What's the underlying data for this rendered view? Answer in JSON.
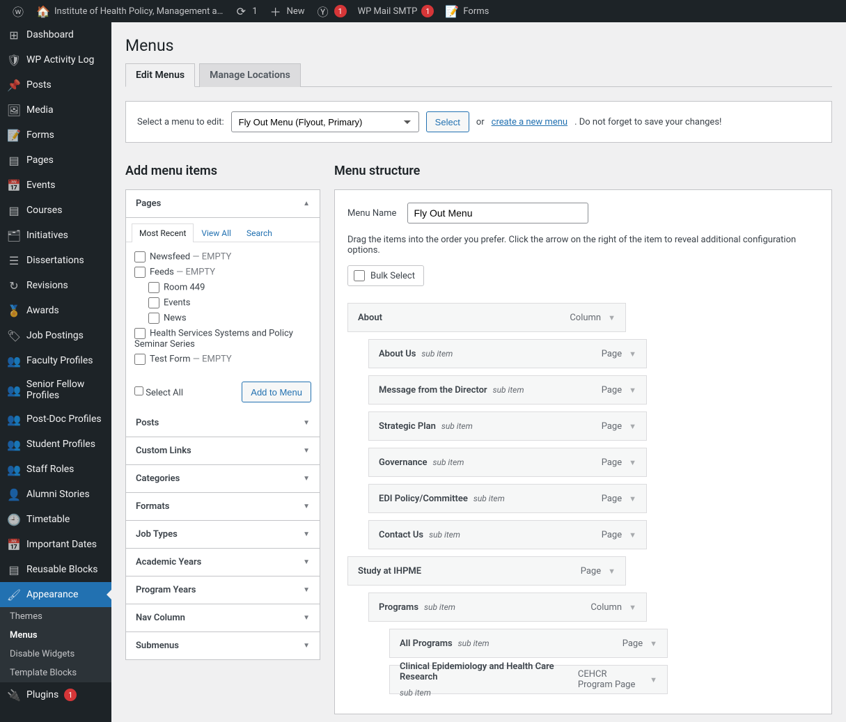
{
  "adminbar": {
    "site_name": "Institute of Health Policy, Management a…",
    "refresh_count": "1",
    "new_label": "New",
    "yoast_count": "1",
    "smtp_label": "WP Mail SMTP",
    "smtp_count": "1",
    "forms_label": "Forms"
  },
  "sidebar": {
    "items": [
      {
        "label": "Dashboard",
        "icon": "⊞"
      },
      {
        "label": "WP Activity Log",
        "icon": "🛡"
      },
      {
        "label": "Posts",
        "icon": "📌"
      },
      {
        "label": "Media",
        "icon": "🖼"
      },
      {
        "label": "Forms",
        "icon": "📝"
      },
      {
        "label": "Pages",
        "icon": "▤"
      },
      {
        "label": "Events",
        "icon": "📅"
      },
      {
        "label": "Courses",
        "icon": "▤"
      },
      {
        "label": "Initiatives",
        "icon": "🗂"
      },
      {
        "label": "Dissertations",
        "icon": "☰"
      },
      {
        "label": "Revisions",
        "icon": "↻"
      },
      {
        "label": "Awards",
        "icon": "🏅"
      },
      {
        "label": "Job Postings",
        "icon": "🏷"
      },
      {
        "label": "Faculty Profiles",
        "icon": "👥"
      },
      {
        "label": "Senior Fellow Profiles",
        "icon": "👥"
      },
      {
        "label": "Post-Doc Profiles",
        "icon": "👥"
      },
      {
        "label": "Student Profiles",
        "icon": "👥"
      },
      {
        "label": "Staff Roles",
        "icon": "👥"
      },
      {
        "label": "Alumni Stories",
        "icon": "👤"
      },
      {
        "label": "Timetable",
        "icon": "🕘"
      },
      {
        "label": "Important Dates",
        "icon": "📅"
      },
      {
        "label": "Reusable Blocks",
        "icon": "▤"
      },
      {
        "label": "Appearance",
        "icon": "🖌"
      },
      {
        "label": "Plugins",
        "icon": "🔌"
      }
    ],
    "appearance_sub": [
      "Themes",
      "Menus",
      "Disable Widgets",
      "Template Blocks"
    ],
    "plugins_badge": "1"
  },
  "page": {
    "title": "Menus",
    "tabs": {
      "edit": "Edit Menus",
      "locations": "Manage Locations"
    },
    "select_label": "Select a menu to edit:",
    "menu_selected": "Fly Out Menu (Flyout, Primary)",
    "select_btn": "Select",
    "or": "or",
    "create_link": "create a new menu",
    "save_note": ". Do not forget to save your changes!"
  },
  "add_items": {
    "heading": "Add menu items",
    "pages_label": "Pages",
    "inner_tabs": {
      "recent": "Most Recent",
      "view_all": "View All",
      "search": "Search"
    },
    "pages": [
      {
        "label": "Newsfeed",
        "suffix": " — EMPTY",
        "sub": false
      },
      {
        "label": "Feeds",
        "suffix": " — EMPTY",
        "sub": false
      },
      {
        "label": "Room 449",
        "suffix": "",
        "sub": true
      },
      {
        "label": "Events",
        "suffix": "",
        "sub": true
      },
      {
        "label": "News",
        "suffix": "",
        "sub": true
      },
      {
        "label": "Health Services Systems and Policy Seminar Series",
        "suffix": "",
        "sub": false
      },
      {
        "label": "Test Form",
        "suffix": " — EMPTY",
        "sub": false
      }
    ],
    "select_all": "Select All",
    "add_btn": "Add to Menu",
    "other_panels": [
      "Posts",
      "Custom Links",
      "Categories",
      "Formats",
      "Job Types",
      "Academic Years",
      "Program Years",
      "Nav Column",
      "Submenus"
    ]
  },
  "structure": {
    "heading": "Menu structure",
    "name_label": "Menu Name",
    "name_value": "Fly Out Menu",
    "help": "Drag the items into the order you prefer. Click the arrow on the right of the item to reveal additional configuration options.",
    "bulk": "Bulk Select",
    "items": [
      {
        "title": "About",
        "sub": "",
        "type": "Column",
        "depth": 0
      },
      {
        "title": "About Us",
        "sub": "sub item",
        "type": "Page",
        "depth": 1
      },
      {
        "title": "Message from the Director",
        "sub": "sub item",
        "type": "Page",
        "depth": 1
      },
      {
        "title": "Strategic Plan",
        "sub": "sub item",
        "type": "Page",
        "depth": 1
      },
      {
        "title": "Governance",
        "sub": "sub item",
        "type": "Page",
        "depth": 1
      },
      {
        "title": "EDI Policy/Committee",
        "sub": "sub item",
        "type": "Page",
        "depth": 1
      },
      {
        "title": "Contact Us",
        "sub": "sub item",
        "type": "Page",
        "depth": 1
      },
      {
        "title": "Study at IHPME",
        "sub": "",
        "type": "Page",
        "depth": 0
      },
      {
        "title": "Programs",
        "sub": "sub item",
        "type": "Column",
        "depth": 1
      },
      {
        "title": "All Programs",
        "sub": "sub item",
        "type": "Page",
        "depth": 2
      },
      {
        "title": "Clinical Epidemiology and Health Care Research",
        "sub": "sub item",
        "type": "CEHCR Program Page",
        "depth": 2
      }
    ]
  }
}
